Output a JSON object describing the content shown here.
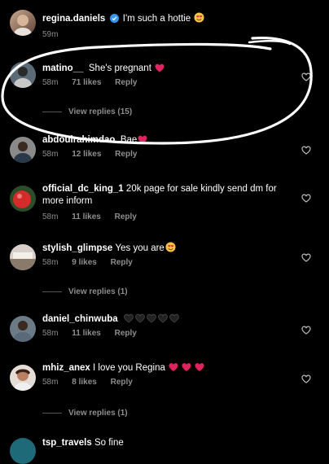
{
  "colors": {
    "background": "#000000",
    "meta": "#8e8e8e",
    "heart_red": "#e0245e",
    "verified_blue": "#3897f0",
    "annotation": "#ffffff"
  },
  "post": {
    "username": "regina.daniels",
    "caption": "I'm such a hottie",
    "caption_emoji": "heart-eyes-emoji",
    "time": "59m"
  },
  "comments": [
    {
      "username": "matino__",
      "text": "She's pregnant",
      "emoji": "red-heart-emoji",
      "time": "58m",
      "likes": "71 likes",
      "reply": "Reply",
      "view_replies": "View replies (15)"
    },
    {
      "username": "abdoulrahimdao",
      "text": "Bae",
      "emoji": "red-heart-emoji",
      "time": "58m",
      "likes": "12 likes",
      "reply": "Reply"
    },
    {
      "username": "official_dc_king_1",
      "text": "20k page for sale kindly send dm for more inform",
      "time": "58m",
      "likes": "11 likes",
      "reply": "Reply"
    },
    {
      "username": "stylish_glimpse",
      "text": "Yes you are",
      "emoji": "heart-eyes-emoji",
      "time": "58m",
      "likes": "9 likes",
      "reply": "Reply",
      "view_replies": "View replies (1)"
    },
    {
      "username": "daniel_chinwuba",
      "text": "",
      "emoji": "five-black-hearts-emoji",
      "time": "58m",
      "likes": "11 likes",
      "reply": "Reply"
    },
    {
      "username": "mhiz_anex",
      "text": "I love you Regina",
      "emoji": "three-red-hearts-emoji",
      "time": "58m",
      "likes": "8 likes",
      "reply": "Reply",
      "view_replies": "View replies (1)"
    },
    {
      "username": "tsp_travels",
      "text": "So fine"
    }
  ]
}
